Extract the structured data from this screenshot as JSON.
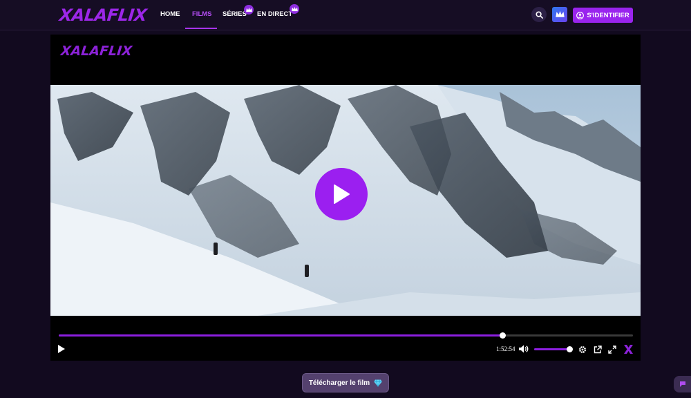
{
  "brand": {
    "name": "XALAFLIX",
    "accent": "#9b1ff0"
  },
  "nav": {
    "items": [
      {
        "label": "HOME",
        "active": false
      },
      {
        "label": "FILMS",
        "active": true
      },
      {
        "label": "SÉRIES",
        "active": false,
        "premium": true
      },
      {
        "label": "EN DIRECT",
        "active": false,
        "premium": true
      }
    ]
  },
  "header_actions": {
    "search_icon": "search-icon",
    "premium_icon": "crown-icon",
    "signin_label": "S'IDENTIFIER"
  },
  "player": {
    "logo": "XALAFLIX",
    "time_display": "1:52:54",
    "progress_fraction": 0.772,
    "volume_fraction": 0.98
  },
  "download": {
    "label": "Télécharger le film",
    "icon": "diamond-icon"
  }
}
